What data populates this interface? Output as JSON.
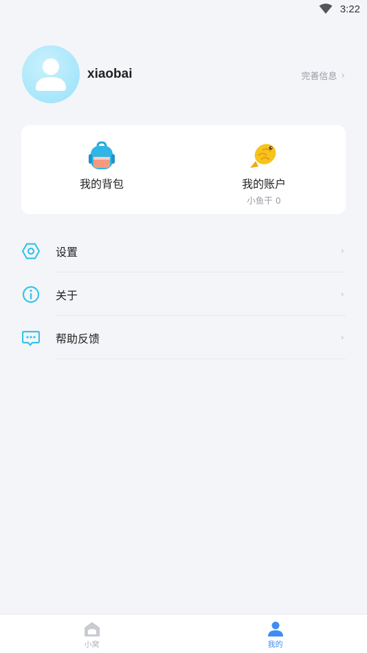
{
  "status_bar": {
    "time": "3:22",
    "icon": "wifi-icon"
  },
  "profile": {
    "username": "xiaobai",
    "complete_info_label": "完善信息",
    "avatar_icon": "user-avatar-icon"
  },
  "card": {
    "backpack": {
      "label": "我的背包",
      "icon": "backpack-icon"
    },
    "account": {
      "label": "我的账户",
      "sub": "小鱼干 0",
      "icon": "fish-icon"
    }
  },
  "menu": {
    "items": [
      {
        "label": "设置",
        "icon": "settings-hexagon-icon"
      },
      {
        "label": "关于",
        "icon": "info-icon"
      },
      {
        "label": "帮助反馈",
        "icon": "feedback-chat-icon"
      }
    ]
  },
  "bottom_nav": {
    "tabs": [
      {
        "label": "小窝",
        "icon": "home-icon",
        "active": false
      },
      {
        "label": "我的",
        "icon": "profile-icon",
        "active": true
      }
    ]
  },
  "colors": {
    "accent": "#3f8cf2",
    "icon_cyan": "#35c3ea",
    "background": "#f4f5f8"
  }
}
